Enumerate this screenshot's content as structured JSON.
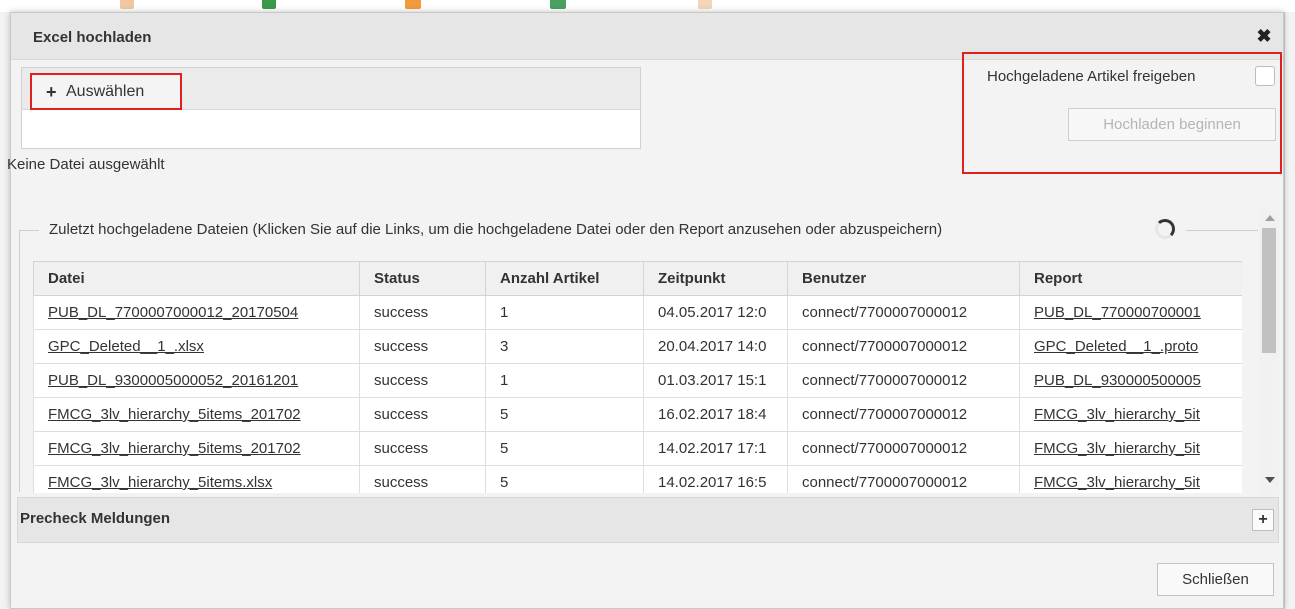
{
  "dialog": {
    "title": "Excel hochladen",
    "close_icon": "close-icon"
  },
  "upload": {
    "select_label": "Auswählen",
    "no_file_text": "Keine Datei ausgewählt"
  },
  "options": {
    "release_label": "Hochgeladene Artikel freigeben",
    "release_checked": false,
    "start_label": "Hochladen beginnen"
  },
  "recent": {
    "legend": "Zuletzt hochgeladene Dateien (Klicken Sie auf die Links, um die hochgeladene Datei oder den Report anzusehen oder abzuspeichern)",
    "columns": [
      "Datei",
      "Status",
      "Anzahl Artikel",
      "Zeitpunkt",
      "Benutzer",
      "Report"
    ],
    "rows": [
      [
        "PUB_DL_7700007000012_20170504",
        "success",
        "1",
        "04.05.2017 12:0",
        "connect/7700007000012",
        "PUB_DL_770000700001"
      ],
      [
        "GPC_Deleted__1_.xlsx",
        "success",
        "3",
        "20.04.2017 14:0",
        "connect/7700007000012",
        "GPC_Deleted__1_.proto"
      ],
      [
        "PUB_DL_9300005000052_20161201",
        "success",
        "1",
        "01.03.2017 15:1",
        "connect/7700007000012",
        "PUB_DL_930000500005"
      ],
      [
        "FMCG_3lv_hierarchy_5items_201702",
        "success",
        "5",
        "16.02.2017 18:4",
        "connect/7700007000012",
        "FMCG_3lv_hierarchy_5it"
      ],
      [
        "FMCG_3lv_hierarchy_5items_201702",
        "success",
        "5",
        "14.02.2017 17:1",
        "connect/7700007000012",
        "FMCG_3lv_hierarchy_5it"
      ],
      [
        "FMCG_3lv_hierarchy_5items.xlsx",
        "success",
        "5",
        "14.02.2017 16:5",
        "connect/7700007000012",
        "FMCG_3lv_hierarchy_5it"
      ]
    ]
  },
  "precheck": {
    "title": "Precheck Meldungen"
  },
  "footer": {
    "close_label": "Schließen"
  },
  "colors": {
    "highlight": "#e0201e",
    "dialog_bg": "#f3f3f3",
    "header_bg": "#e6e6e6"
  }
}
